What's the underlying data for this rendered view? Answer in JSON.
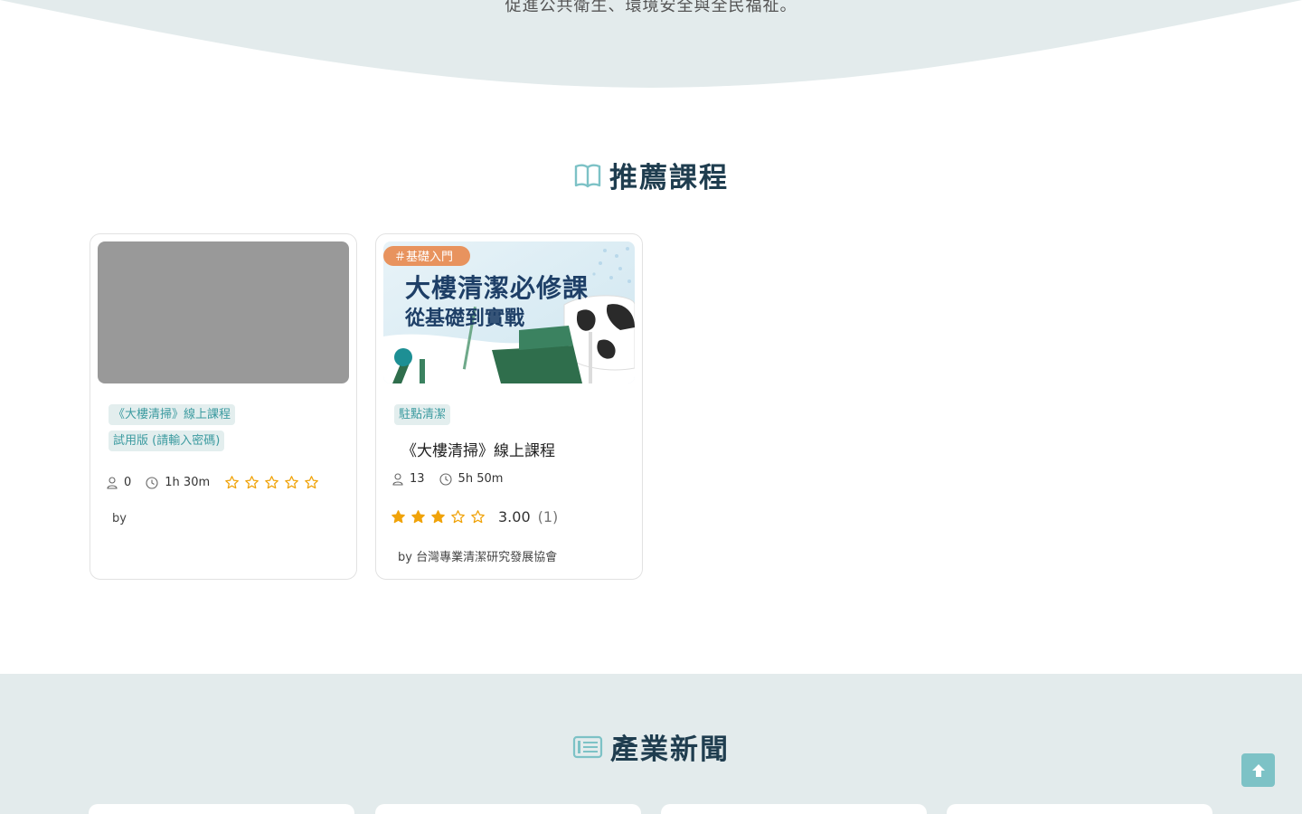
{
  "hero": {
    "text": "促進公共衛生、環境安全與全民福祉。"
  },
  "courses_section": {
    "title": "推薦課程",
    "icon": "book-open-icon"
  },
  "courses": [
    {
      "tags": [
        "《大樓清掃》線上課程",
        "試用版 (請輸入密碼)"
      ],
      "title": "",
      "students": "0",
      "duration": "1h 30m",
      "rating": 0,
      "rating_value": "",
      "rating_count": "",
      "author": "by"
    },
    {
      "thumbnail": {
        "badge": "＃基礎入門",
        "headline": "大樓清潔必修課",
        "subline": "從基礎到實戰"
      },
      "tags": [
        "駐點清潔"
      ],
      "title": "《大樓清掃》線上課程",
      "students": "13",
      "duration": "5h 50m",
      "rating": 3,
      "rating_value": "3.00",
      "rating_count": "(1)",
      "author": "by 台灣專業清潔研究發展協會"
    }
  ],
  "news_section": {
    "title": "產業新聞",
    "icon": "newspaper-icon"
  },
  "colors": {
    "accent": "#7dc2c6",
    "tag_bg": "#e3eeee",
    "tag_text": "#3c9ba0",
    "star": "#f0a30a",
    "title": "#1f3d4f",
    "band": "#e3ebec"
  },
  "scroll_top": {
    "icon": "arrow-up-icon"
  }
}
